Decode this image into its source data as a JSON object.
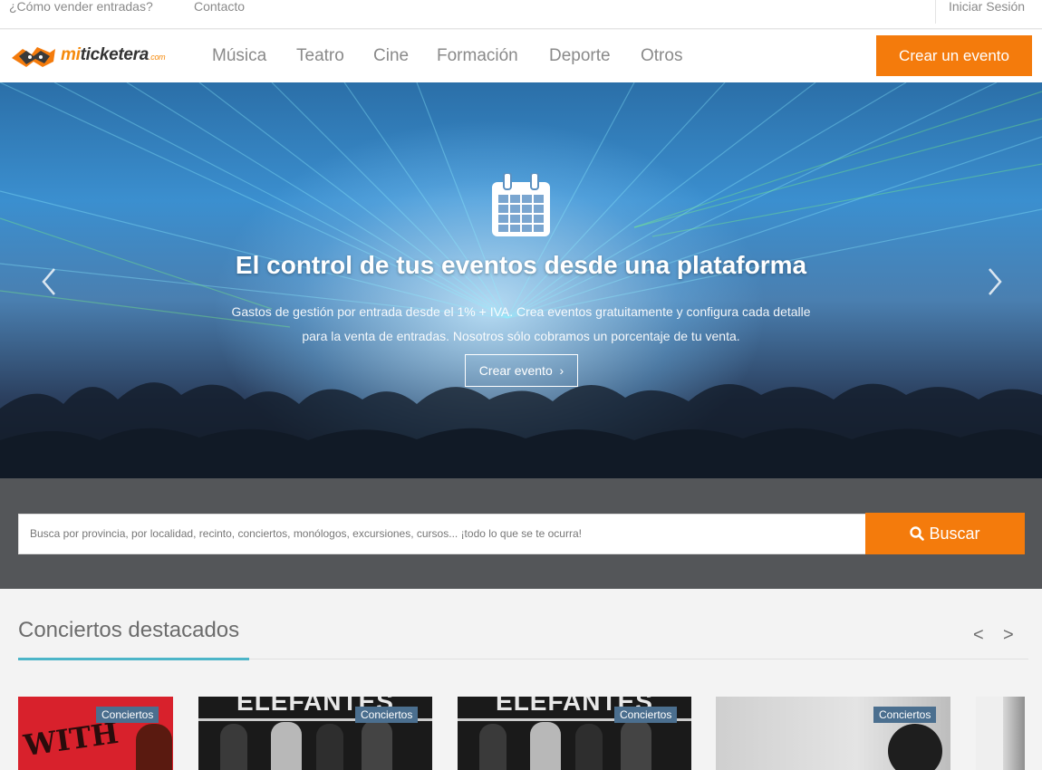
{
  "topbar": {
    "how_to_sell": "¿Cómo vender entradas?",
    "contact": "Contacto",
    "login": "Iniciar Sesión"
  },
  "brand": {
    "name_mi": "mi",
    "name_rest": "ticketera",
    "name_suffix": ".com",
    "accent_color": "#f47b0c"
  },
  "nav": {
    "items": [
      "Música",
      "Teatro",
      "Cine",
      "Formación",
      "Deporte",
      "Otros"
    ],
    "create_button": "Crear un evento"
  },
  "hero": {
    "icon": "calendar-icon",
    "title": "El control de tus eventos desde una plataforma",
    "subtitle_line1": "Gastos de gestión por entrada desde el 1% + IVA. Crea eventos gratuitamente y configura cada detalle",
    "subtitle_line2": "para la venta de entradas. Nosotros sólo cobramos un porcentaje de tu venta.",
    "button": "Crear evento",
    "button_arrow": "›"
  },
  "search": {
    "placeholder": "Busca por provincia, por localidad, recinto, conciertos, monólogos, excursiones, cursos... ¡todo lo que se te ocurra!",
    "button": "Buscar"
  },
  "featured": {
    "title": "Conciertos destacados",
    "prev": "<",
    "next": ">",
    "cards": [
      {
        "badge": "Conciertos",
        "art_text": "WITH"
      },
      {
        "badge": "Conciertos",
        "art_text": "ELEFANTES"
      },
      {
        "badge": "Conciertos",
        "art_text": "ELEFANTES"
      },
      {
        "badge": "Conciertos",
        "art_text": ""
      }
    ]
  }
}
